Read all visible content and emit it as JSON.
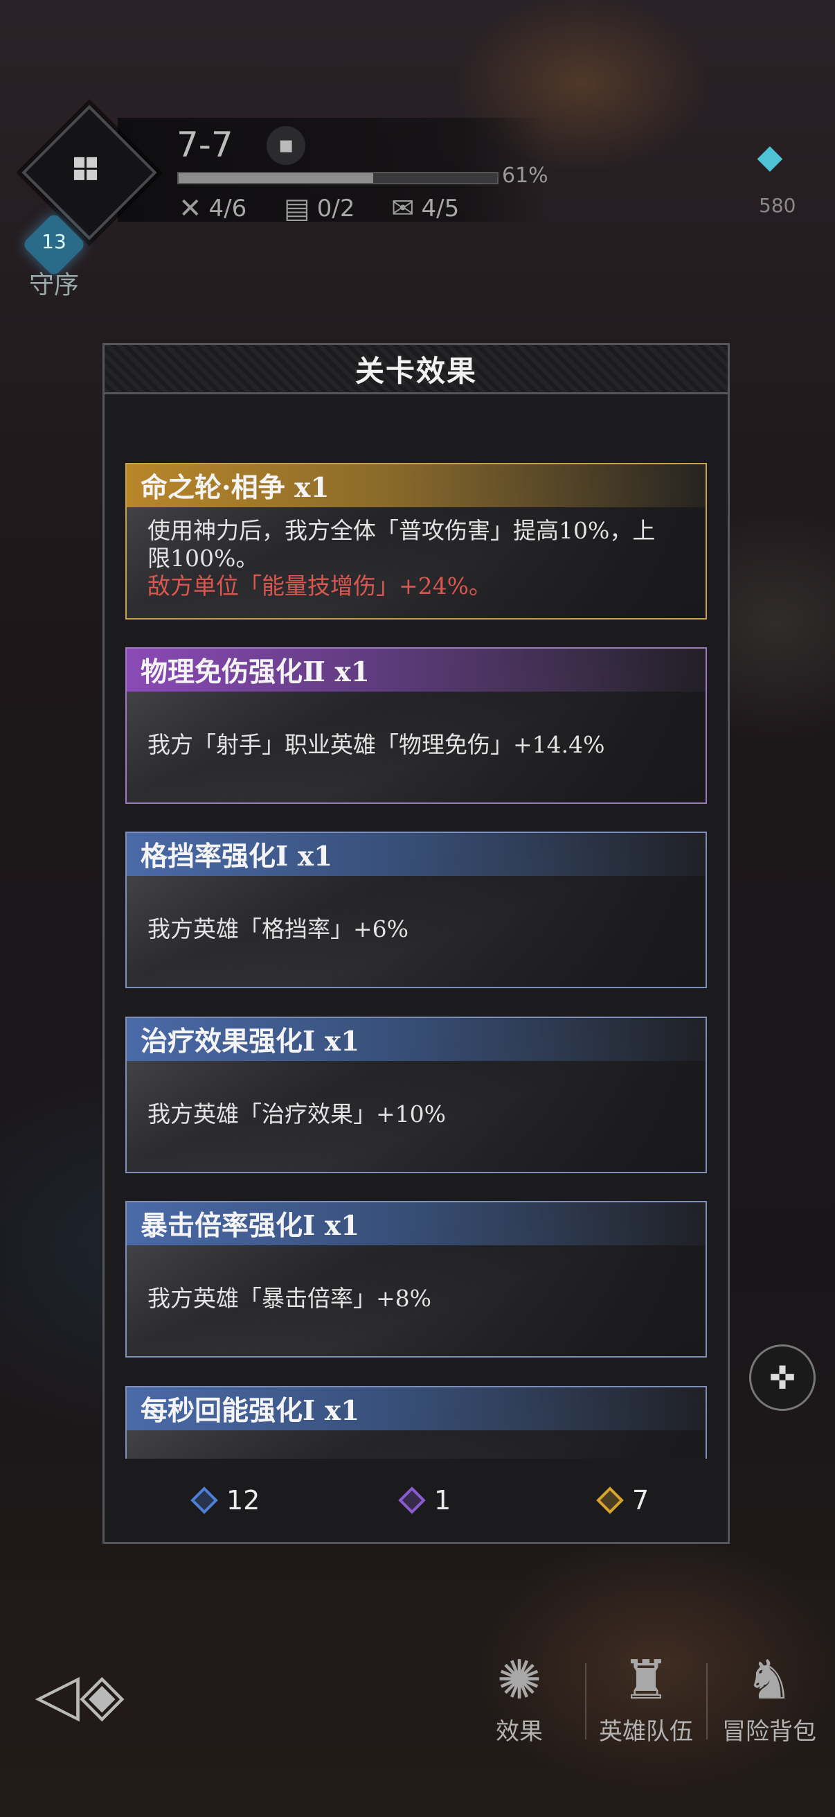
{
  "hud": {
    "level": "7-7",
    "progress_percent": 61,
    "progress_text": "61%",
    "stats": [
      {
        "icon": "crossed-swords-icon",
        "value": "4/6"
      },
      {
        "icon": "chest-icon",
        "value": "0/2"
      },
      {
        "icon": "scroll-icon",
        "value": "4/5"
      }
    ],
    "badge_number": "13",
    "badge_label": "守序",
    "top_right_count": "580"
  },
  "panel": {
    "title": "关卡效果",
    "cards": [
      {
        "theme": "gold",
        "title": "命之轮·相争 x1",
        "desc": "使用神力后，我方全体「普攻伤害」提高10%，上限100%。",
        "desc_red": "敌方单位「能量技增伤」+24%。"
      },
      {
        "theme": "purple",
        "title": "物理免伤强化Ⅱ x1",
        "desc": "我方「射手」职业英雄「物理免伤」+14.4%"
      },
      {
        "theme": "blue",
        "title": "格挡率强化Ⅰ x1",
        "desc": "我方英雄「格挡率」+6%"
      },
      {
        "theme": "blue",
        "title": "治疗效果强化Ⅰ x1",
        "desc": "我方英雄「治疗效果」+10%"
      },
      {
        "theme": "blue",
        "title": "暴击倍率强化Ⅰ x1",
        "desc": "我方英雄「暴击倍率」+8%"
      },
      {
        "theme": "blue",
        "title": "每秒回能强化Ⅰ x1",
        "desc": ""
      }
    ],
    "footer": [
      {
        "gem": "blue",
        "count": "12"
      },
      {
        "gem": "purple",
        "count": "1"
      },
      {
        "gem": "gold",
        "count": "7"
      }
    ]
  },
  "bottom_nav": [
    {
      "icon": "effects-icon",
      "label": "效果"
    },
    {
      "icon": "hero-team-icon",
      "label": "英雄队伍"
    },
    {
      "icon": "adventure-bag-icon",
      "label": "冒险背包"
    }
  ],
  "colors": {
    "gold_accent": "#c9a247",
    "purple_accent": "#a276c7",
    "blue_accent": "#7e90b8",
    "red_text": "#d9574e"
  }
}
